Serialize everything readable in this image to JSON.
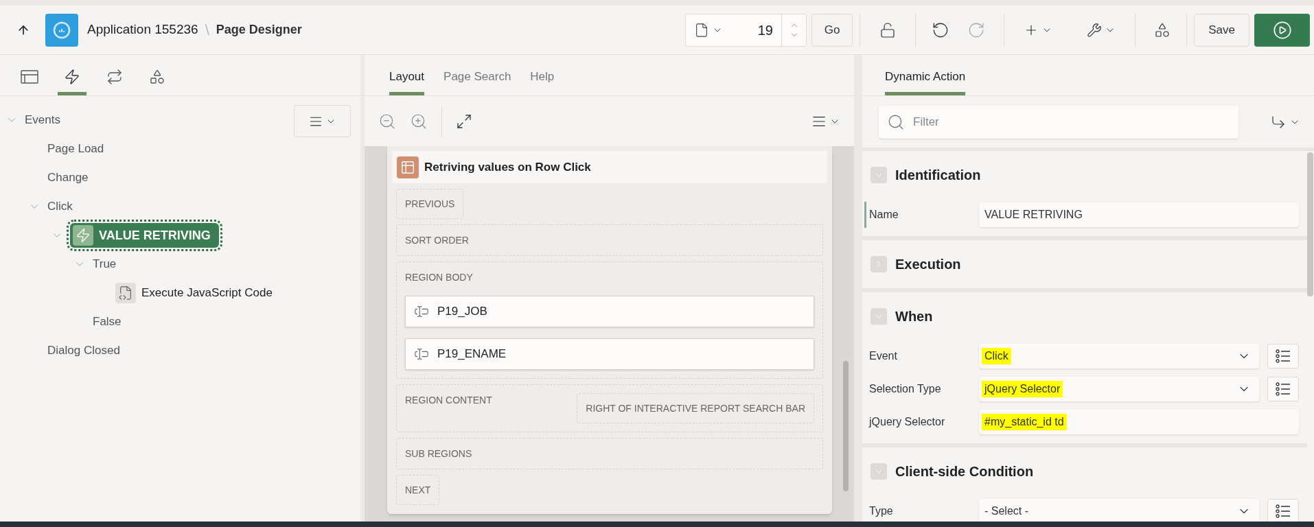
{
  "header": {
    "app_name": "Application 155236",
    "separator": "\\",
    "page_title": "Page Designer",
    "page_number": "19",
    "go_label": "Go",
    "save_label": "Save"
  },
  "left_tabs": [
    {
      "kind": "rendering",
      "selected": false
    },
    {
      "kind": "dynamic-actions",
      "selected": true
    },
    {
      "kind": "processing",
      "selected": false
    },
    {
      "kind": "shared",
      "selected": false
    }
  ],
  "tree": {
    "label": "Events",
    "expanded": true,
    "children": [
      {
        "label": "Page Load"
      },
      {
        "label": "Change"
      },
      {
        "label": "Click",
        "expanded": true,
        "children": [
          {
            "kind": "action",
            "label": "VALUE RETRIVING",
            "selected": true,
            "expanded": true,
            "children": [
              {
                "label": "True",
                "expanded": true,
                "children": [
                  {
                    "kind": "javascript",
                    "label": "Execute JavaScript Code"
                  }
                ]
              },
              {
                "label": "False"
              }
            ]
          }
        ]
      },
      {
        "label": "Dialog Closed"
      }
    ]
  },
  "center_tabs": [
    {
      "label": "Layout",
      "selected": true
    },
    {
      "label": "Page Search",
      "selected": false
    },
    {
      "label": "Help",
      "selected": false
    }
  ],
  "region": {
    "title": "Retriving values on Row Click",
    "slots": [
      {
        "kind": "small",
        "label": "PREVIOUS"
      },
      {
        "kind": "wide",
        "label": "SORT ORDER"
      },
      {
        "kind": "items",
        "label": "REGION BODY",
        "items": [
          "P19_JOB",
          "P19_ENAME"
        ]
      },
      {
        "kind": "split",
        "label": "REGION CONTENT",
        "side_label": "RIGHT OF INTERACTIVE REPORT SEARCH BAR"
      },
      {
        "kind": "wide",
        "label": "SUB REGIONS"
      },
      {
        "kind": "small",
        "label": "NEXT"
      }
    ]
  },
  "right_tabs": [
    {
      "label": "Dynamic Action",
      "selected": true
    }
  ],
  "filter": {
    "placeholder": "Filter"
  },
  "sections": [
    {
      "title": "Identification",
      "expanded": true,
      "fields": [
        {
          "label": "Name",
          "kind": "text",
          "value": "VALUE RETRIVING",
          "highlighted": false,
          "current": true
        }
      ]
    },
    {
      "title": "Execution",
      "expanded": false
    },
    {
      "title": "When",
      "expanded": true,
      "fields": [
        {
          "label": "Event",
          "kind": "select",
          "value": "Click",
          "highlighted": true,
          "current": false
        },
        {
          "label": "Selection Type",
          "kind": "select",
          "value": "jQuery Selector",
          "highlighted": true,
          "current": false
        },
        {
          "label": "jQuery Selector",
          "kind": "text",
          "value": "#my_static_id td",
          "highlighted": true,
          "current": false
        }
      ]
    },
    {
      "title": "Client-side Condition",
      "expanded": true,
      "fields": [
        {
          "label": "Type",
          "kind": "select",
          "value": "- Select -",
          "highlighted": false,
          "current": false
        }
      ]
    }
  ]
}
